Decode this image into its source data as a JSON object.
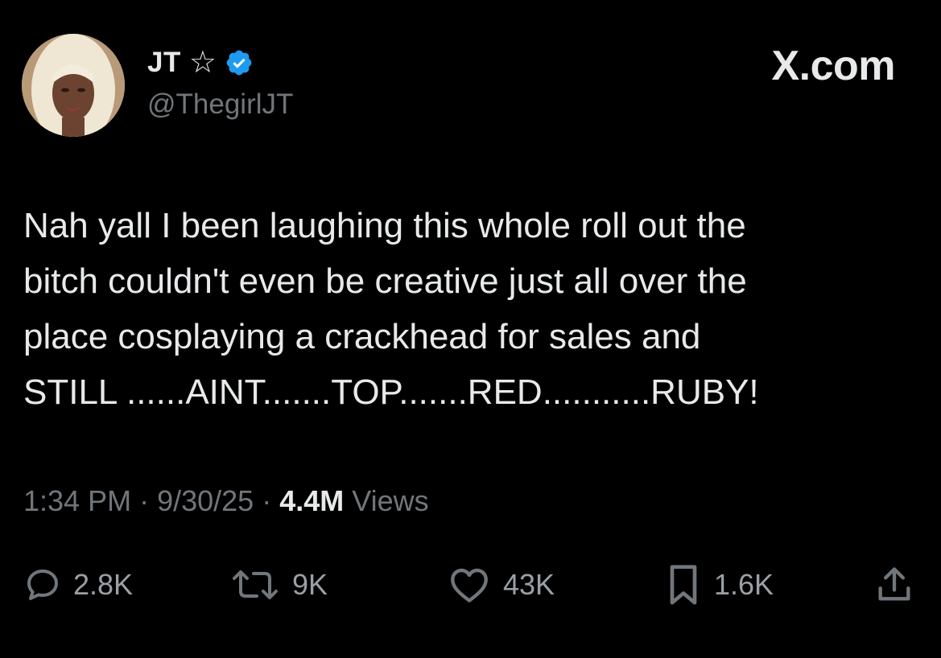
{
  "header": {
    "display_name": "JT",
    "handle": "@ThegirlJT",
    "brand": "X.com",
    "star_icon": "star-outline-icon",
    "verified_icon": "verified-badge-icon",
    "verified_color": "#1d9bf0"
  },
  "tweet": {
    "text": "Nah yall I been laughing this whole roll out the\nbitch couldn't even be creative just all over the\nplace cosplaying a crackhead for sales and\nSTILL ......AINT.......TOP.......RED...........RUBY!"
  },
  "meta": {
    "time": "1:34 PM",
    "separator": " · ",
    "date": "9/30/25",
    "views_count": "4.4M",
    "views_label": " Views"
  },
  "actions": {
    "reply_count": "2.8K",
    "repost_count": "9K",
    "like_count": "43K",
    "bookmark_count": "1.6K"
  },
  "colors": {
    "background": "#000000",
    "text_primary": "#e7e9ea",
    "text_secondary": "#71767b",
    "accent": "#1d9bf0"
  }
}
